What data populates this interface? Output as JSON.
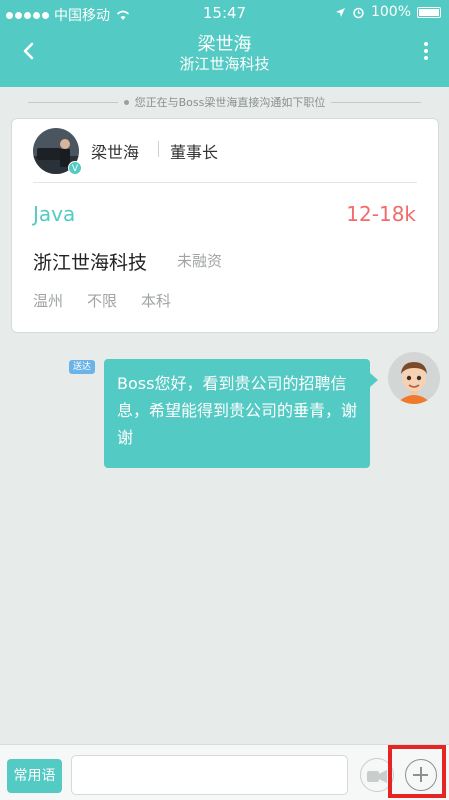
{
  "status_bar": {
    "carrier": "中国移动",
    "time": "15:47",
    "battery": "100%"
  },
  "header": {
    "title": "梁世海",
    "subtitle": "浙江世海科技"
  },
  "notice": "您正在与Boss梁世海直接沟通如下职位",
  "job_card": {
    "boss_name": "梁世海",
    "boss_title": "董事长",
    "verified_badge": "V",
    "job_title": "Java",
    "salary": "12-18k",
    "company": "浙江世海科技",
    "funding": "未融资",
    "tags": [
      "温州",
      "不限",
      "本科"
    ]
  },
  "message": {
    "status": "送达",
    "text": "Boss您好，看到贵公司的招聘信息，希望能得到贵公司的垂青，谢谢"
  },
  "input_bar": {
    "phrases_label": "常用语",
    "input_value": ""
  },
  "icons": {
    "back": "back-arrow-icon",
    "more": "more-vertical-icon",
    "plus": "plus-icon",
    "media": "media-icon"
  },
  "colors": {
    "accent": "#53cac3",
    "salary": "#f26b6b",
    "highlight": "#e52424"
  }
}
